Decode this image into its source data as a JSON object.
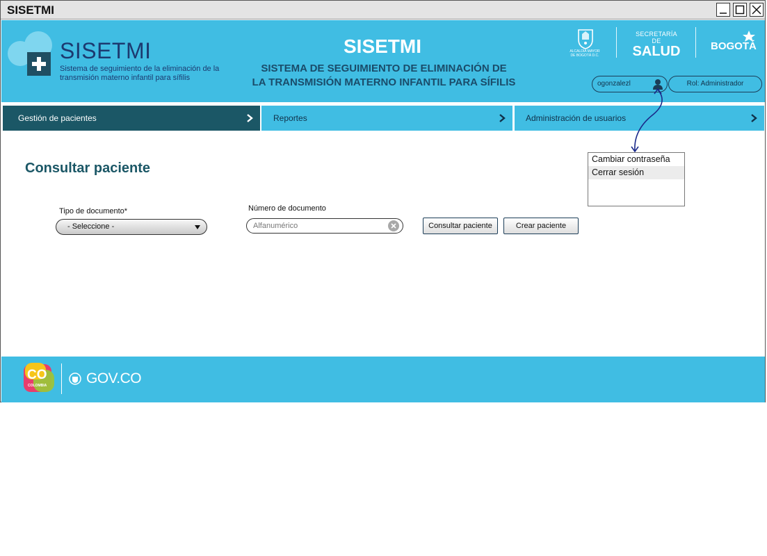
{
  "window": {
    "title": "SISETMI"
  },
  "header": {
    "logo_name": "SISETMI",
    "logo_subtitle": "Sistema de seguimiento de la eliminación de la transmisión materno infantil para sífilis",
    "title": "SISETMI",
    "subtitle_line1": "SISTEMA DE SEGUIMIENTO DE ELIMINACIÓN DE",
    "subtitle_line2": "LA TRANSMISIÓN MATERNO INFANTIL PARA SÍFILIS",
    "alcaldia_text": "ALCALDÍA MAYOR DE BOGOTÁ D.C.",
    "secretaria_line1": "SECRETARÍA DE",
    "secretaria_line2": "SALUD",
    "bogota_text": "BOGOTÁ",
    "username": "ogonzalezl",
    "role": "Rol: Administrador"
  },
  "nav": {
    "items": [
      {
        "label": "Gestión de pacientes"
      },
      {
        "label": "Reportes"
      },
      {
        "label": "Administración de usuarios"
      }
    ]
  },
  "user_menu": {
    "items": [
      {
        "label": "Cambiar contraseña"
      },
      {
        "label": "Cerrar sesión"
      }
    ]
  },
  "main": {
    "page_title": "Consultar paciente",
    "doc_type_label": "Tipo de documento*",
    "doc_type_value": "- Seleccione -",
    "doc_number_label": "Número de documento",
    "doc_number_placeholder": "Alfanumérico",
    "consult_button": "Consultar paciente",
    "create_button": "Crear paciente"
  },
  "footer": {
    "co_text": "CO",
    "co_sub": "COLOMBIA",
    "govco": "GOV.CO"
  },
  "colors": {
    "brand_blue": "#40bde3",
    "nav_active": "#1b5766",
    "title_dark": "#1b5766",
    "logo_navy": "#1c3a70"
  }
}
